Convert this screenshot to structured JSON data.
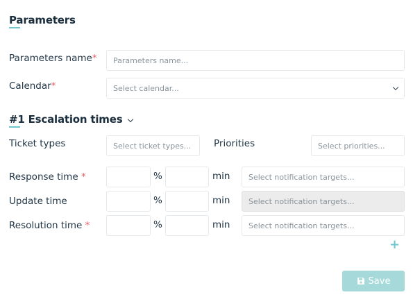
{
  "header": {
    "title": "Parameters"
  },
  "form": {
    "name_label": "Parameters name",
    "name_required": "*",
    "name_placeholder": "Parameters name...",
    "calendar_label": "Calendar",
    "calendar_required": "*",
    "calendar_placeholder": "Select calendar..."
  },
  "escalation": {
    "title": "#1 Escalation times",
    "ticket_types_label": "Ticket types",
    "ticket_types_placeholder": "Select ticket types...",
    "priorities_label": "Priorities",
    "priorities_placeholder": "Select priorities...",
    "rows": [
      {
        "label": "Response time",
        "required": "*",
        "pct_symbol": "%",
        "unit": "min",
        "targets_placeholder": "Select notification targets...",
        "targets_disabled": false
      },
      {
        "label": "Update time",
        "required": "",
        "pct_symbol": "%",
        "unit": "min",
        "targets_placeholder": "Select notification targets...",
        "targets_disabled": true
      },
      {
        "label": "Resolution time",
        "required": "*",
        "pct_symbol": "%",
        "unit": "min",
        "targets_placeholder": "Select notification targets...",
        "targets_disabled": false
      }
    ],
    "add_symbol": "+"
  },
  "footer": {
    "save_label": "Save"
  },
  "colors": {
    "accent": "#6fc6cf",
    "required": "#e0626a",
    "save_bg": "#a6d9d9"
  },
  "icons": {
    "select_arrow": "chevron-down-icon",
    "section_toggle": "chevron-down-icon",
    "add": "plus-icon",
    "save": "floppy-disk-icon"
  }
}
